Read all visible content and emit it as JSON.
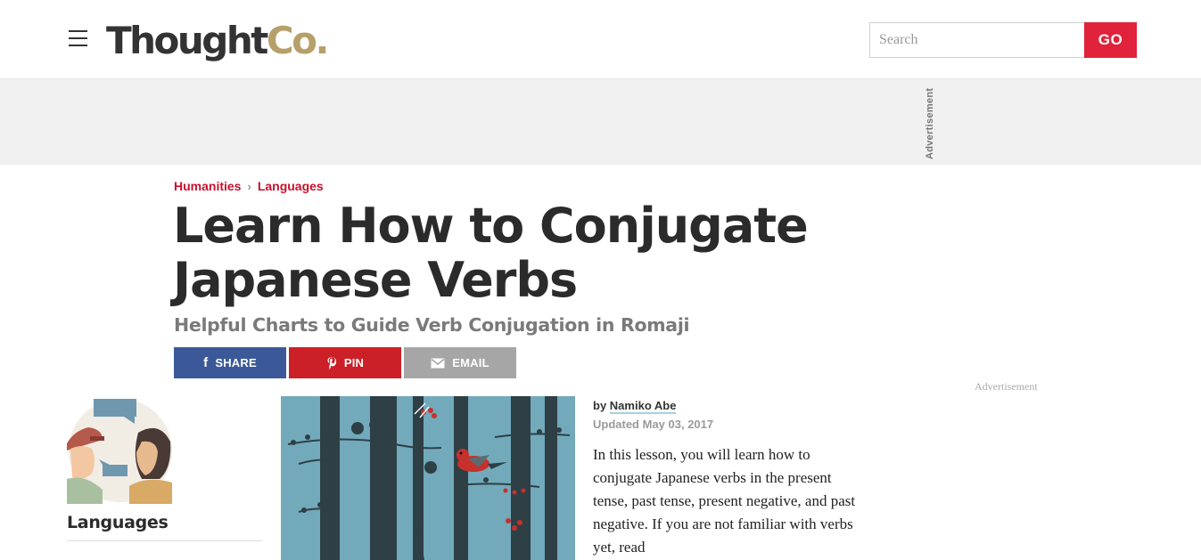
{
  "header": {
    "logo_main": "Thought",
    "logo_accent": "Co.",
    "search_placeholder": "Search",
    "go_label": "GO"
  },
  "ads": {
    "top_label": "Advertisement",
    "side_label": "Advertisement"
  },
  "breadcrumb": {
    "items": [
      "Humanities",
      "Languages"
    ],
    "separator": "›"
  },
  "article": {
    "title": "Learn How to Conjugate Japanese Verbs",
    "subtitle": "Helpful Charts to Guide Verb Conjugation in Romaji",
    "byline_prefix": "by",
    "author": "Namiko Abe",
    "updated": "Updated May 03, 2017",
    "body": "In this lesson, you will learn how to conjugate Japanese verbs in the present tense, past tense, present negative, and past negative. If you are not familiar with verbs yet, read"
  },
  "share": {
    "facebook_label": "SHARE",
    "pinterest_label": "PIN",
    "email_label": "EMAIL"
  },
  "sidebar": {
    "category_label": "Languages"
  },
  "colors": {
    "brand_red": "#e0223a",
    "logo_gold": "#b6a06a",
    "facebook": "#3b5998",
    "pinterest": "#cb2027",
    "email": "#a6a6a6"
  }
}
